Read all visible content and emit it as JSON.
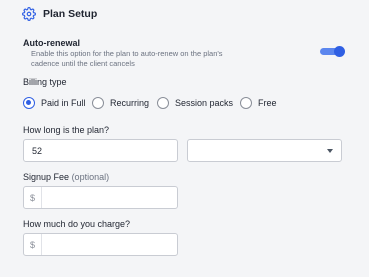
{
  "header": {
    "title": "Plan Setup",
    "icon": "gear-icon"
  },
  "auto_renewal": {
    "label": "Auto-renewal",
    "description": "Enable this option for the plan to auto-renew on the plan's cadence until the client cancels",
    "enabled": true
  },
  "billing": {
    "label": "Billing type",
    "options": [
      "Paid in Full",
      "Recurring",
      "Session packs",
      "Free"
    ],
    "selected": "Paid in Full"
  },
  "duration": {
    "label": "How long is the plan?",
    "value": "52",
    "unit_selected": ""
  },
  "signup_fee": {
    "label": "Signup Fee",
    "optional": "(optional)",
    "prefix": "$",
    "value": ""
  },
  "price": {
    "label": "How much do you charge?",
    "prefix": "$",
    "value": ""
  },
  "colors": {
    "accent": "#2f5fe3",
    "background": "#f4f5f7"
  }
}
